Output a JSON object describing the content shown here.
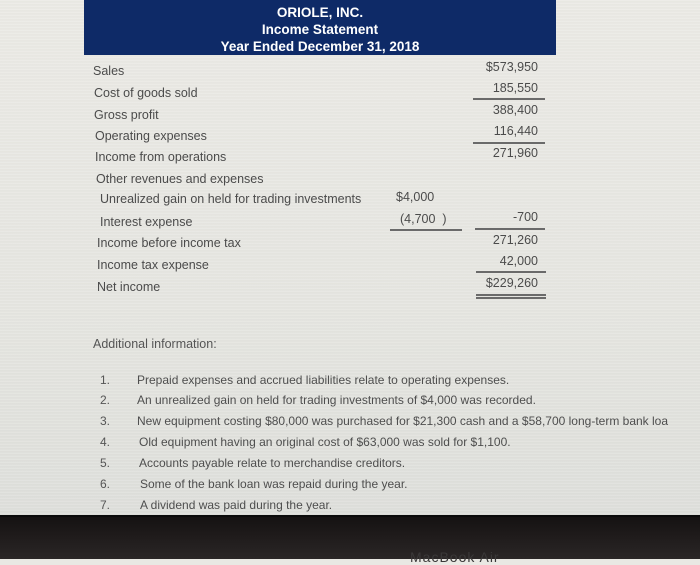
{
  "statement": {
    "company": "ORIOLE, INC.",
    "title": "Income Statement",
    "period": "Year Ended December 31, 2018",
    "header_color": "#0e2a67",
    "rows": [
      {
        "label": "Sales",
        "inner": "",
        "outer": "$573,950"
      },
      {
        "label": "Cost of goods sold",
        "inner": "",
        "outer": "185,550"
      },
      {
        "label": "Gross profit",
        "inner": "",
        "outer": "388,400"
      },
      {
        "label": "Operating expenses",
        "inner": "",
        "outer": "116,440"
      },
      {
        "label": "Income from operations",
        "inner": "",
        "outer": "271,960"
      },
      {
        "label": "Other revenues and expenses",
        "inner": "",
        "outer": ""
      },
      {
        "label": "Unrealized gain on held for trading investments",
        "inner": "$4,000",
        "outer": ""
      },
      {
        "label": "Interest expense",
        "inner": "(4,700  )",
        "outer": "-700"
      },
      {
        "label": "Income before income tax",
        "inner": "",
        "outer": "271,260"
      },
      {
        "label": "Income tax expense",
        "inner": "",
        "outer": "42,000"
      },
      {
        "label": "Net income",
        "inner": "",
        "outer": "$229,260"
      }
    ]
  },
  "additional": {
    "title": "Additional information:",
    "notes": [
      {
        "num": "1.",
        "text": "Prepaid expenses and accrued liabilities relate to operating expenses."
      },
      {
        "num": "2.",
        "text": "An unrealized gain on held for trading investments of $4,000 was recorded."
      },
      {
        "num": "3.",
        "text": "New equipment costing $80,000 was purchased for $21,300 cash and a $58,700 long-term bank loa"
      },
      {
        "num": "4.",
        "text": "Old equipment having an original cost of $63,000 was sold for $1,100."
      },
      {
        "num": "5.",
        "text": "Accounts payable relate to merchandise creditors."
      },
      {
        "num": "6.",
        "text": "Some of the bank loan was repaid during the year."
      },
      {
        "num": "7.",
        "text": "A dividend was paid during the year."
      }
    ]
  },
  "device": {
    "bezel_label": "MacBook Air"
  }
}
